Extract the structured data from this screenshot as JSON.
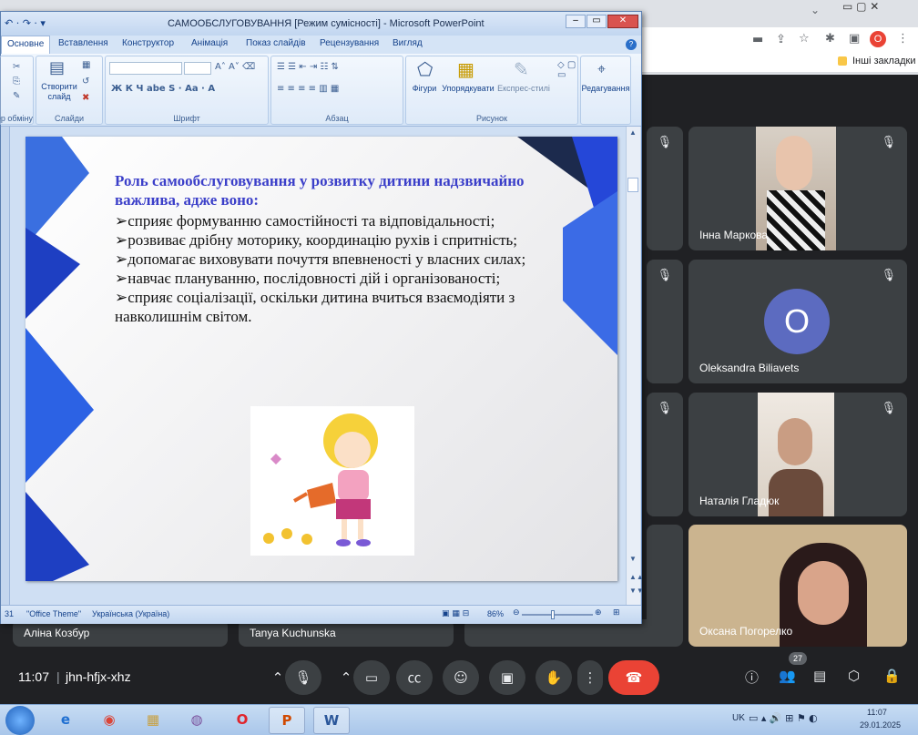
{
  "chrome": {
    "bookmarks_label": "Інші закладки",
    "profile_initial": "O"
  },
  "ppt": {
    "title": "САМООБСЛУГОВУВАННЯ [Режим сумісності] - Microsoft PowerPoint",
    "tabs": [
      "Основне",
      "Вставлення",
      "Конструктор",
      "Анімація",
      "Показ слайдів",
      "Рецензування",
      "Вигляд"
    ],
    "groups": {
      "clipboard_label": "Буфер обміну",
      "slides_label": "Слайди",
      "font_label": "Шрифт",
      "paragraph_label": "Абзац",
      "drawing_label": "Рисунок",
      "editing_label": "Редагування",
      "new_slide_label": "Створити слайд",
      "shapes_label": "Фігури",
      "arrange_label": "Упорядкувати",
      "quick_styles_label": "Експрес-стилі"
    },
    "slide": {
      "title": "Роль самообслуговування у розвитку дитини надзвичайно важлива, адже воно:",
      "bullets": [
        "сприяє формуванню самостійності та відповідальності;",
        "розвиває дрібну моторику, координацію рухів і спритність;",
        "допомагає виховувати почуття впевненості у власних силах;",
        "навчає плануванню, послідовності дій і організованості;",
        "сприяє соціалізації, оскільки дитина вчиться взаємодіяти з навколишнім світом."
      ]
    },
    "status": {
      "slide_num": "31",
      "theme": "\"Office Theme\"",
      "language": "Українська (Україна)",
      "zoom": "86%"
    }
  },
  "meet": {
    "participants": [
      {
        "name": "Інна Маркова"
      },
      {
        "name": "Oleksandra Biliavets",
        "initial": "O"
      },
      {
        "name": "Наталія Гладюк"
      },
      {
        "name": "Оксана Погорелко"
      },
      {
        "name": "Аліна Козбур"
      },
      {
        "name": "Tanya Kuchunska"
      }
    ],
    "time": "11:07",
    "code": "jhn-hfjx-xhz",
    "people_count": "27"
  },
  "taskbar": {
    "lang": "UK",
    "time": "11:07",
    "date": "29.01.2025"
  },
  "colors": {
    "slide_title": "#3b3fc9",
    "end_call": "#ea4335",
    "avatar": "#5c6bc0"
  }
}
